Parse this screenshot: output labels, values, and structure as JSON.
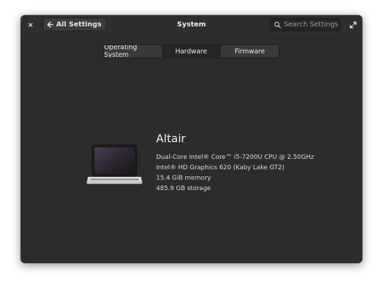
{
  "window": {
    "title": "System",
    "back_label": "All Settings",
    "search_placeholder": "Search Settings",
    "close_symbol": "×"
  },
  "tabs": [
    {
      "label": "Operating System",
      "active": false
    },
    {
      "label": "Hardware",
      "active": true
    },
    {
      "label": "Firmware",
      "active": false
    }
  ],
  "device": {
    "icon": "laptop-icon",
    "hostname": "Altair",
    "specs": [
      "Dual-Core Intel® Core™ i5-7200U CPU @ 2.50GHz",
      "Intel® HD Graphics 620 (Kaby Lake GT2)",
      "15.4 GiB memory",
      "485.9 GB storage"
    ]
  },
  "colors": {
    "window_bg": "#2c2c2c",
    "text": "#e4e4e4",
    "active_tab": "#262626",
    "inactive_tab": "#3a3a3a"
  }
}
